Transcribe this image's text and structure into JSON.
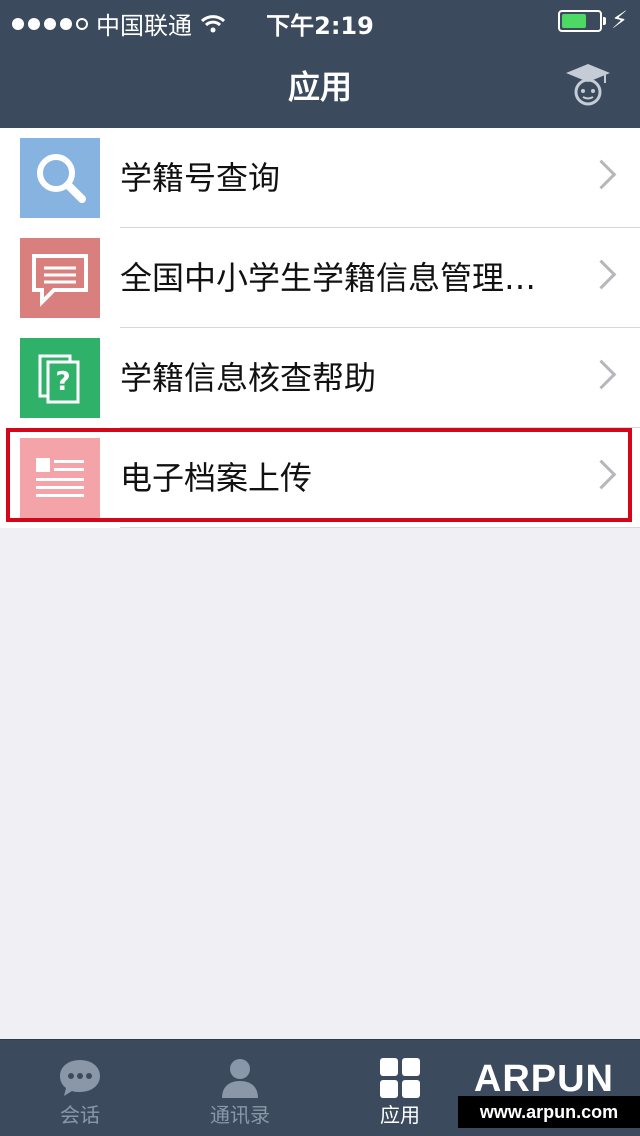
{
  "status_bar": {
    "carrier": "中国联通",
    "time": "下午2:19"
  },
  "header": {
    "title": "应用",
    "cap_icon": "graduation-cap-icon"
  },
  "apps": [
    {
      "label": "学籍号查询",
      "icon": "magnifier-icon",
      "color": "#86b3e0"
    },
    {
      "label": "全国中小学生学籍信息管理系统",
      "icon": "message-icon",
      "color": "#d9807f"
    },
    {
      "label": "学籍信息核查帮助",
      "icon": "question-doc-icon",
      "color": "#2fb16a"
    },
    {
      "label": "电子档案上传",
      "icon": "document-list-icon",
      "color": "#f4a3a9"
    }
  ],
  "highlight_color": "#d4061a",
  "tabbar": {
    "tabs": [
      {
        "label": "会话",
        "icon": "chat-bubble-icon",
        "active": false
      },
      {
        "label": "通讯录",
        "icon": "contacts-icon",
        "active": false
      },
      {
        "label": "应用",
        "icon": "apps-grid-icon",
        "active": true
      }
    ]
  },
  "watermark": {
    "logo": "ARPUN",
    "url": "www.arpun.com"
  },
  "colors": {
    "header_bg": "#3b4a5c",
    "page_bg": "#efeff4"
  }
}
